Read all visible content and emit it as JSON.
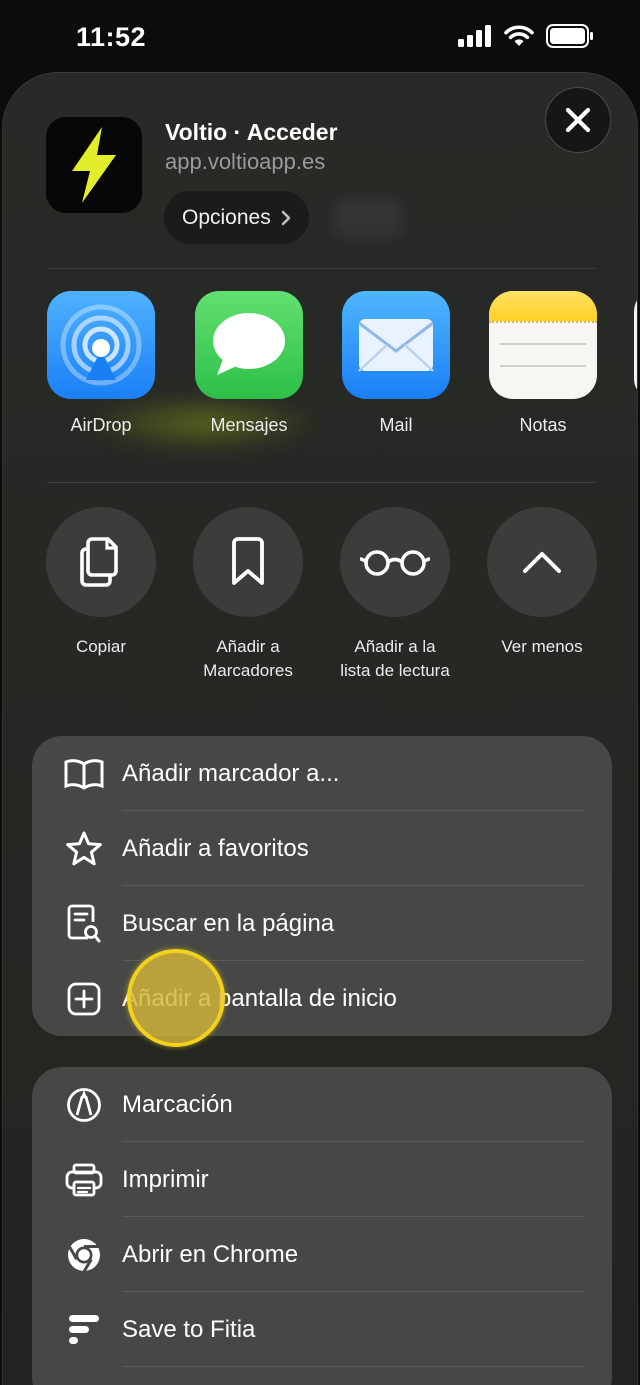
{
  "status_bar": {
    "time": "11:52"
  },
  "header": {
    "title": "Voltio · Acceder",
    "url": "app.voltioapp.es",
    "options_label": "Opciones"
  },
  "apps": [
    {
      "label": "AirDrop",
      "icon": "airdrop-icon",
      "color": "#1a7ff5"
    },
    {
      "label": "Mensajes",
      "icon": "messages-icon",
      "color": "#34c759"
    },
    {
      "label": "Mail",
      "icon": "mail-icon",
      "color": "#1c8bf5"
    },
    {
      "label": "Notas",
      "icon": "notes-icon",
      "color": "#ffd535"
    }
  ],
  "actions": [
    {
      "label": "Copiar",
      "icon": "copy-icon"
    },
    {
      "label": "Añadir a Marcadores",
      "icon": "bookmark-icon"
    },
    {
      "label": "Añadir a la lista de lectura",
      "icon": "glasses-icon"
    },
    {
      "label": "Ver menos",
      "icon": "chevron-up-icon"
    }
  ],
  "menu_group_1": [
    {
      "label": "Añadir marcador a...",
      "icon": "book-icon"
    },
    {
      "label": "Añadir a favoritos",
      "icon": "star-icon"
    },
    {
      "label": "Buscar en la página",
      "icon": "find-in-page-icon"
    },
    {
      "label": "Añadir a pantalla de inicio",
      "icon": "add-square-icon"
    }
  ],
  "menu_group_2": [
    {
      "label": "Marcación",
      "icon": "markup-icon"
    },
    {
      "label": "Imprimir",
      "icon": "printer-icon"
    },
    {
      "label": "Abrir en Chrome",
      "icon": "chrome-icon"
    },
    {
      "label": "Save to Fitia",
      "icon": "fitia-icon"
    }
  ],
  "colors": {
    "accent_tap": "#f2d21a",
    "app_icon_bolt": "#e2ee2a",
    "sheet_bg": "#262824",
    "group_bg": "#474846"
  }
}
